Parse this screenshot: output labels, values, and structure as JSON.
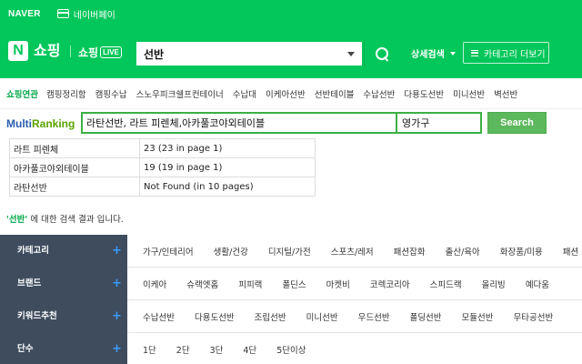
{
  "topbar": {
    "naver": "NAVER",
    "pay": "네이버페이"
  },
  "header": {
    "n_logo": "N",
    "shop": "쇼핑",
    "live_label": "쇼핑",
    "live_badge": "LIVE",
    "search_value": "선반",
    "adv_search": "상세검색",
    "category_more": "카테고리 더보기"
  },
  "related": {
    "label": "쇼핑연관",
    "items": [
      "캠핑정리함",
      "캠핑수납",
      "스노우피크쉘프컨테이너",
      "수납대",
      "이케아선반",
      "선반테이블",
      "수납선반",
      "다용도선반",
      "미니선반",
      "벽선반"
    ]
  },
  "multiranking": {
    "logo_multi": "Multi",
    "logo_ranking": "Ranking",
    "keywords": "라탄선반, 라트 피렌체,아카풀코야외테이블",
    "store": "영가구",
    "search_button": "Search",
    "results": [
      {
        "keyword": "라트 피렌체",
        "result": "23 (23 in page 1)"
      },
      {
        "keyword": "아카풀코야외테이블",
        "result": "19 (19 in page 1)"
      },
      {
        "keyword": "라탄선반",
        "result": "Not Found (in 10 pages)"
      }
    ]
  },
  "result_note": {
    "query": "'선반'",
    "suffix": " 에 대한 검색 결과 입니다."
  },
  "filters": [
    {
      "label": "카테고리",
      "plus": "+",
      "values": [
        "가구/인테리어",
        "생활/건강",
        "디지털/가전",
        "스포츠/레저",
        "패션잡화",
        "출산/육아",
        "화장품/미용",
        "패션"
      ]
    },
    {
      "label": "브랜드",
      "plus": "+",
      "values": [
        "이케아",
        "슈랙엣홈",
        "피피랙",
        "폴딘스",
        "마켓비",
        "코렉코리아",
        "스피드랙",
        "올리빙",
        "예다움"
      ]
    },
    {
      "label": "키워드추천",
      "plus": "+",
      "values": [
        "수납선반",
        "다용도선반",
        "조립선반",
        "미니선반",
        "우드선반",
        "폴딩선반",
        "모듈선반",
        "무타공선반"
      ]
    },
    {
      "label": "단수",
      "plus": "+",
      "values": [
        "1단",
        "2단",
        "3단",
        "4단",
        "5단이상"
      ]
    }
  ],
  "colors": {
    "naver_green": "#03c75a",
    "filter_bg": "#3e4c5e",
    "plus_blue": "#3b9bff"
  }
}
